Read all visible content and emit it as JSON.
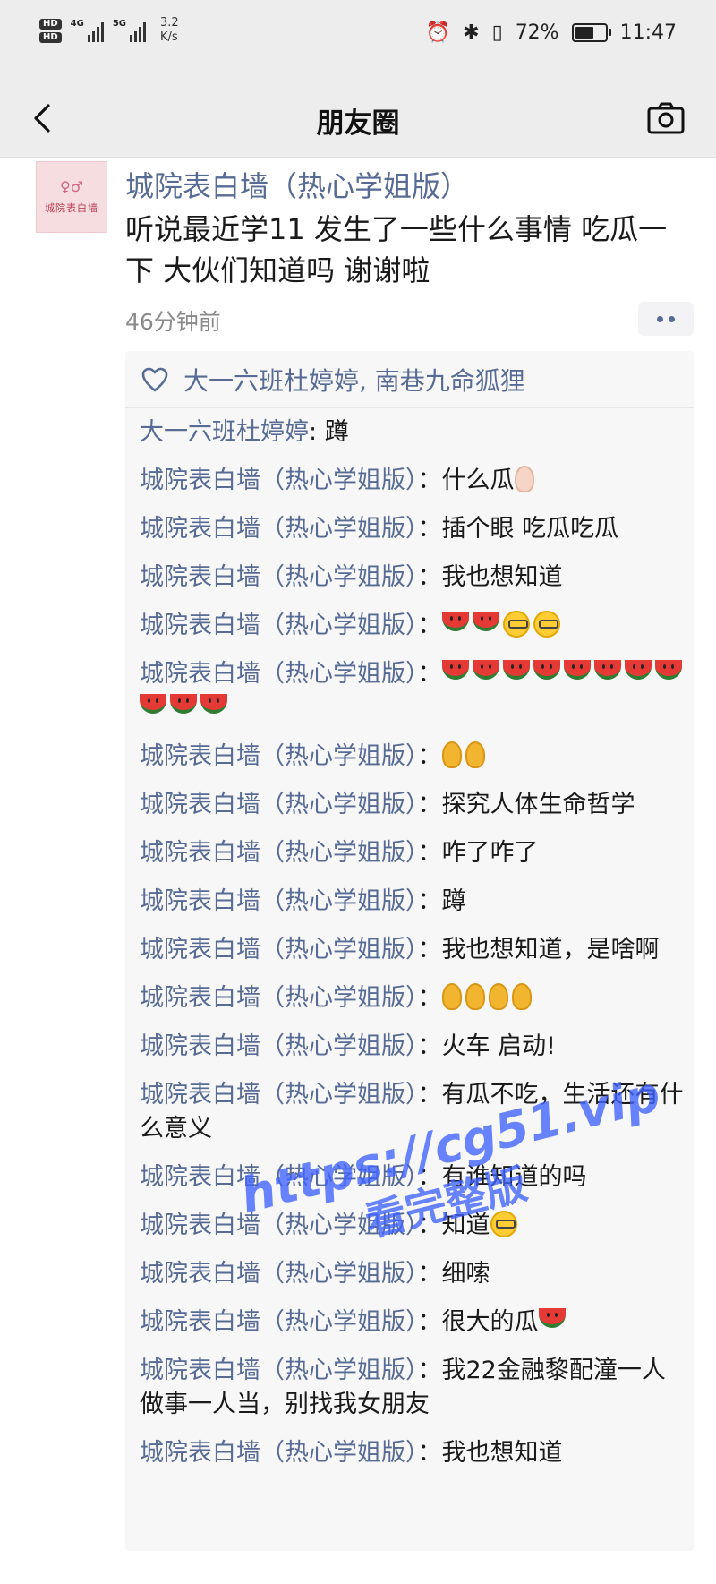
{
  "status_bar": {
    "left_badges": [
      "HD",
      "HD"
    ],
    "net_1": "4G",
    "net_2": "5G",
    "speed_value": "3.2",
    "speed_unit": "K/s",
    "battery": "72%",
    "battery_level": 0.72,
    "time": "11:47"
  },
  "nav": {
    "title": "朋友圈"
  },
  "post": {
    "author": "城院表白墙（热心学姐版）",
    "content": "听说最近学11 发生了一些什么事情  吃瓜一下  大伙们知道吗  谢谢啦",
    "time": "46分钟前",
    "avatar_text": "城院表白墙"
  },
  "likes": {
    "names": "大一六班杜婷婷, 南巷九命狐狸"
  },
  "comments": [
    {
      "name": "大一六班杜婷婷",
      "sep": ": ",
      "text": "蹲",
      "emojis": []
    },
    {
      "name": "城院表白墙（热心学姐版）",
      "sep": "：",
      "text": "什么瓜",
      "emojis": [
        "ear-pale"
      ]
    },
    {
      "name": "城院表白墙（热心学姐版）",
      "sep": "：",
      "text": "插个眼 吃瓜吃瓜",
      "emojis": []
    },
    {
      "name": "城院表白墙（热心学姐版）",
      "sep": "：",
      "text": "我也想知道",
      "emojis": []
    },
    {
      "name": "城院表白墙（热心学姐版）",
      "sep": "：",
      "text": "",
      "emojis": [
        "melon",
        "melon",
        "face",
        "face"
      ]
    },
    {
      "name": "城院表白墙（热心学姐版）",
      "sep": "：",
      "text": "",
      "emojis": [
        "melon",
        "melon",
        "melon",
        "melon",
        "melon",
        "melon",
        "melon",
        "melon",
        "melon",
        "melon",
        "melon"
      ]
    },
    {
      "name": "城院表白墙（热心学姐版）",
      "sep": "：",
      "text": "",
      "emojis": [
        "ear",
        "ear"
      ]
    },
    {
      "name": "城院表白墙（热心学姐版）",
      "sep": "：",
      "text": "探究人体生命哲学",
      "emojis": []
    },
    {
      "name": "城院表白墙（热心学姐版）",
      "sep": "：",
      "text": "咋了咋了",
      "emojis": []
    },
    {
      "name": "城院表白墙（热心学姐版）",
      "sep": "：",
      "text": "蹲",
      "emojis": []
    },
    {
      "name": "城院表白墙（热心学姐版）",
      "sep": "：",
      "text": "我也想知道，是啥啊",
      "emojis": []
    },
    {
      "name": "城院表白墙（热心学姐版）",
      "sep": "：",
      "text": "",
      "emojis": [
        "ear",
        "ear",
        "ear",
        "ear"
      ]
    },
    {
      "name": "城院表白墙（热心学姐版）",
      "sep": "：",
      "text": "火车 启动!",
      "emojis": []
    },
    {
      "name": "城院表白墙（热心学姐版）",
      "sep": "：",
      "text": "有瓜不吃，生活还有什么意义",
      "emojis": []
    },
    {
      "name": "城院表白墙（热心学姐版）",
      "sep": "：",
      "text": "有谁知道的吗",
      "emojis": []
    },
    {
      "name": "城院表白墙（热心学姐版）",
      "sep": "：",
      "text": "知道",
      "emojis": [
        "face"
      ]
    },
    {
      "name": "城院表白墙（热心学姐版）",
      "sep": "：",
      "text": "细嗦",
      "emojis": []
    },
    {
      "name": "城院表白墙（热心学姐版）",
      "sep": "：",
      "text": "很大的瓜",
      "emojis": [
        "melon"
      ]
    },
    {
      "name": "城院表白墙（热心学姐版）",
      "sep": "：",
      "text": "我22金融黎配潼一人做事一人当，别找我女朋友",
      "emojis": []
    },
    {
      "name": "城院表白墙（热心学姐版）",
      "sep": "：",
      "text": "我也想知道",
      "emojis": []
    }
  ],
  "watermark": {
    "line1": "https://cg51.vip",
    "line2": "看完整版"
  },
  "colors": {
    "link": "#576b95",
    "bar_bg": "#ededed",
    "comment_bg": "#f7f7f7"
  }
}
